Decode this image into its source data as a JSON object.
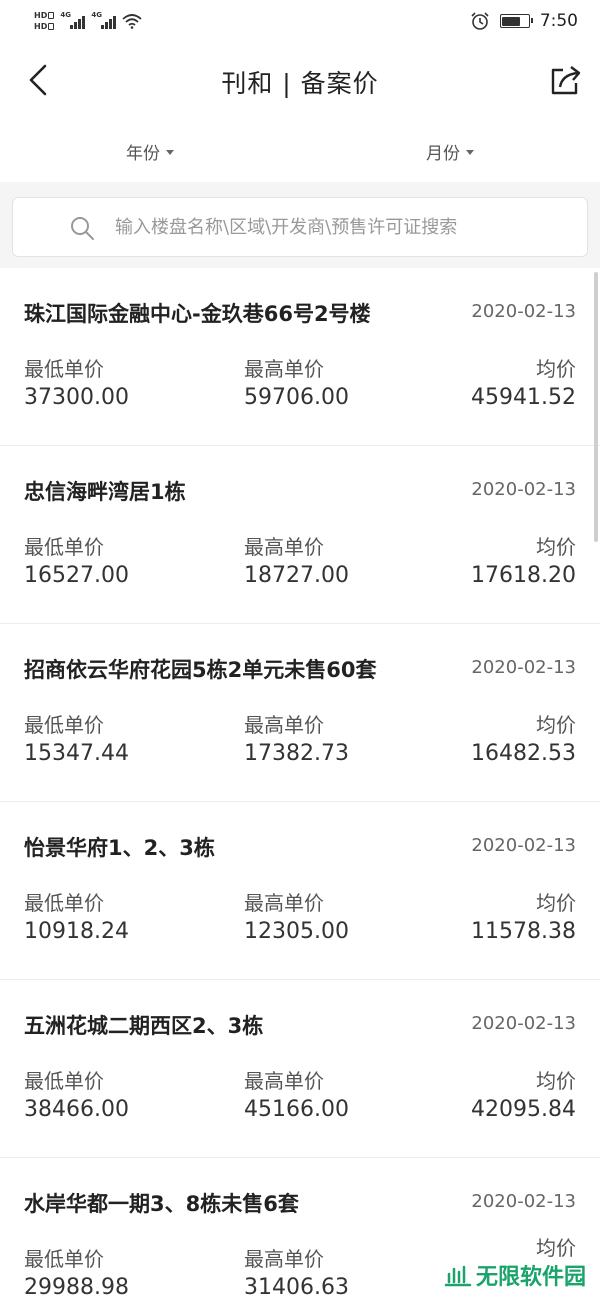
{
  "status_bar": {
    "hd1": "HD",
    "hd2": "HD",
    "sig1": "4G",
    "sig2": "4G",
    "time": "7:50",
    "icons": [
      "alarm-icon",
      "battery-icon",
      "wifi-icon"
    ]
  },
  "nav": {
    "title": "刊和 | 备案价",
    "back_icon": "chevron-left-icon",
    "share_icon": "share-icon"
  },
  "filters": {
    "year_label": "年份",
    "month_label": "月份"
  },
  "search": {
    "placeholder": "输入楼盘名称\\区域\\开发商\\预售许可证搜索",
    "value": ""
  },
  "labels": {
    "min": "最低单价",
    "max": "最高单价",
    "avg": "均价"
  },
  "records": [
    {
      "name": "珠江国际金融中心-金玖巷66号2号楼",
      "date": "2020-02-13",
      "min": "37300.00",
      "max": "59706.00",
      "avg": "45941.52"
    },
    {
      "name": "忠信海畔湾居1栋",
      "date": "2020-02-13",
      "min": "16527.00",
      "max": "18727.00",
      "avg": "17618.20"
    },
    {
      "name": "招商依云华府花园5栋2单元未售60套",
      "date": "2020-02-13",
      "min": "15347.44",
      "max": "17382.73",
      "avg": "16482.53"
    },
    {
      "name": "怡景华府1、2、3栋",
      "date": "2020-02-13",
      "min": "10918.24",
      "max": "12305.00",
      "avg": "11578.38"
    },
    {
      "name": "五洲花城二期西区2、3栋",
      "date": "2020-02-13",
      "min": "38466.00",
      "max": "45166.00",
      "avg": "42095.84"
    },
    {
      "name": "水岸华都一期3、8栋未售6套",
      "date": "2020-02-13",
      "min": "29988.98",
      "max": "31406.63",
      "avg": ""
    }
  ],
  "watermark": {
    "text": "无限软件园"
  },
  "colors": {
    "accent_green": "#1aa36a",
    "search_bg": "#f5f5f5"
  }
}
